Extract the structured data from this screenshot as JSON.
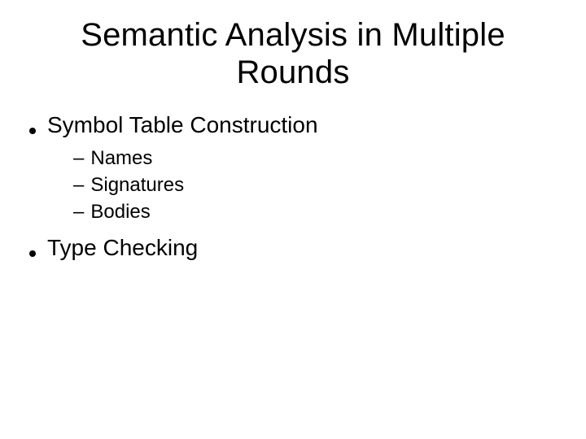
{
  "title": "Semantic Analysis in Multiple Rounds",
  "bullets": [
    {
      "level": 1,
      "text": "Symbol Table Construction"
    },
    {
      "level": 2,
      "text": "Names"
    },
    {
      "level": 2,
      "text": "Signatures"
    },
    {
      "level": 2,
      "text": "Bodies"
    },
    {
      "level": 1,
      "text": "Type Checking"
    }
  ]
}
